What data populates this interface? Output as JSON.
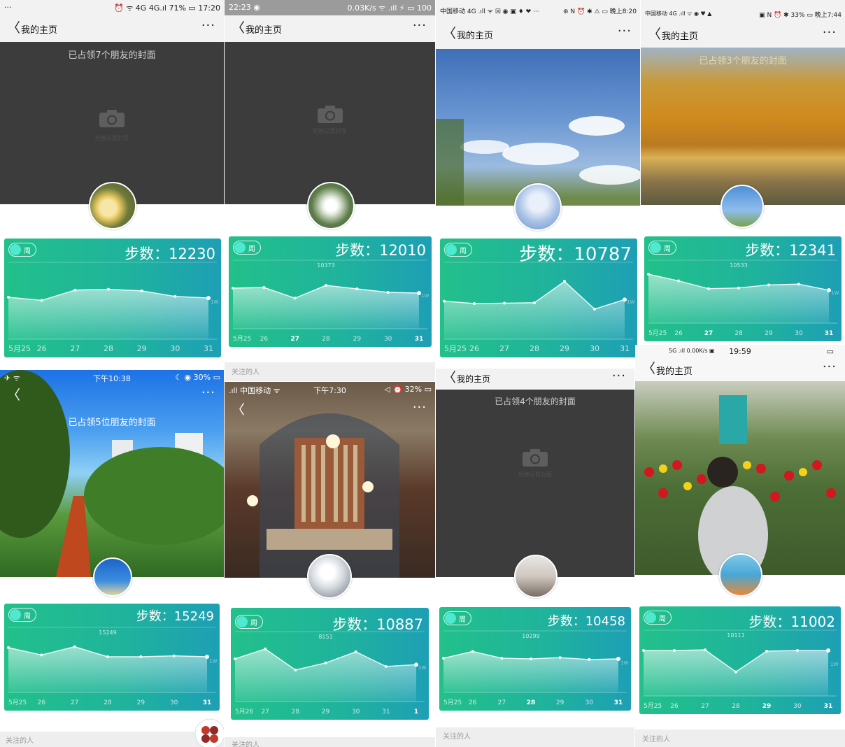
{
  "colors": {
    "card_start": "#22c08a",
    "card_end": "#1e9fb5",
    "cover_dark": "#3c3c3c",
    "toggle_knob": "#4fe8d0"
  },
  "icons": {
    "back": "chevron-left-icon",
    "more": "more-dots-icon",
    "camera": "camera-icon"
  },
  "week_toggle_label": "周",
  "page_title": "我的主页",
  "back_glyph": "〈",
  "more_glyph": "···",
  "panels": [
    {
      "status": {
        "left": "···",
        "right": "⏰ ᯤ 4G 4G.ıl 71% ▭ 17:20"
      },
      "cover_caption": "已占领7个朋友的封面",
      "camera_hint": "轻触设置封面",
      "steps_text": "步数：12230",
      "chart_data": {
        "type": "area",
        "categories": [
          "5月25",
          "26",
          "27",
          "28",
          "29",
          "30",
          "31"
        ],
        "values": [
          11300,
          10900,
          12200,
          12300,
          12100,
          11400,
          11200
        ],
        "ylim": [
          6000,
          15000
        ],
        "peak_label": "",
        "end_label": "1W",
        "bold_last": false
      }
    },
    {
      "status": {
        "left": "22:23 ◉",
        "right": "0.03K/s ᯤ .ıll ⚡ ▭ 100"
      },
      "camera_hint": "轻触设置封面",
      "steps_text": "步数：12010",
      "chart_data": {
        "type": "area",
        "categories": [
          "5月25",
          "26",
          "27",
          "28",
          "29",
          "30",
          "31"
        ],
        "values": [
          11800,
          11900,
          10373,
          12200,
          11700,
          11200,
          11100
        ],
        "ylim": [
          6000,
          15000
        ],
        "peak_label": "10373",
        "end_label": "1W",
        "bold_last": true,
        "bold_index": 2
      },
      "below_label": "关注的人"
    },
    {
      "status": {
        "left": "中国移动 4G .ıll ᯤ ☒ ◉ ▣ ♦ ❤ ···",
        "right": "⊛ N ⏰ ✱ ⚠ ▭ 晚上8:20"
      },
      "steps_text": "步数：10787",
      "chart_data": {
        "type": "area",
        "categories": [
          "5月25",
          "26",
          "27",
          "28",
          "29",
          "30",
          "31"
        ],
        "values": [
          9800,
          9500,
          9550,
          9600,
          12300,
          8800,
          10000
        ],
        "ylim": [
          5000,
          14000
        ],
        "peak_label": "",
        "end_label": "1W",
        "bold_last": false
      }
    },
    {
      "status": {
        "left": "中国移动 4G .ıll ᯤ ◉ ♥ ▲",
        "right": "▣ N ⏰ ✱ 33% ▭ 晚上7:44"
      },
      "cover_caption": "已占领3个朋友的封面",
      "steps_text": "步数：12341",
      "chart_data": {
        "type": "area",
        "categories": [
          "5月25",
          "26",
          "27",
          "28",
          "29",
          "30",
          "31"
        ],
        "values": [
          11400,
          10533,
          9500,
          9600,
          10000,
          10100,
          9300
        ],
        "ylim": [
          5000,
          12500
        ],
        "peak_label": "10533",
        "end_label": "1W",
        "bold_last": true,
        "bold_index": 2
      }
    },
    {
      "status": {
        "left": "✈ ᯤ",
        "center": "下午10:38",
        "right": "☾ ◉ 30% ▭"
      },
      "cover_caption": "已占领5位朋友的封面",
      "steps_text": "步数：15249",
      "chart_data": {
        "type": "area",
        "categories": [
          "5月25",
          "26",
          "27",
          "28",
          "29",
          "30",
          "31"
        ],
        "values": [
          13800,
          12200,
          14000,
          11800,
          11800,
          12000,
          11800
        ],
        "ylim": [
          4000,
          17000
        ],
        "peak_label": "15249",
        "end_label": "1W",
        "bold_last": true
      },
      "below_label": "关注的人"
    },
    {
      "status": {
        "left": ".ıll 中国移动 ᯤ",
        "center": "下午7:30",
        "right": "◁ ⏰ 32% ▭"
      },
      "steps_text": "步数：10887",
      "chart_data": {
        "type": "area",
        "categories": [
          "5月26",
          "27",
          "28",
          "29",
          "30",
          "31",
          "1"
        ],
        "values": [
          10300,
          12000,
          8400,
          9600,
          11500,
          9000,
          9300
        ],
        "ylim": [
          3000,
          14000
        ],
        "peak_label": "8151",
        "end_label": "1W",
        "bold_last": true
      },
      "below_label": "关注的人"
    },
    {
      "cover_caption": "已占领4个朋友的封面",
      "camera_hint": "轻触设置封面",
      "steps_text": "步数：10458",
      "chart_data": {
        "type": "area",
        "categories": [
          "5月25",
          "26",
          "27",
          "28",
          "29",
          "30",
          "31"
        ],
        "values": [
          10500,
          11600,
          10500,
          10400,
          10600,
          10300,
          10400
        ],
        "ylim": [
          5000,
          14000
        ],
        "peak_label": "10299",
        "end_label": "1W",
        "bold_last": true,
        "bold_index": 3
      },
      "below_label": "关注的人"
    },
    {
      "status": {
        "left": "5G .ıll 0.00K/s ▣",
        "center": "19:59",
        "right": "▭"
      },
      "steps_text": "步数：11002",
      "chart_data": {
        "type": "area",
        "categories": [
          "5月25",
          "26",
          "27",
          "28",
          "29",
          "30",
          "31"
        ],
        "values": [
          10800,
          10800,
          10900,
          7600,
          10700,
          10800,
          10800
        ],
        "ylim": [
          4000,
          13000
        ],
        "peak_label": "10111",
        "end_label": "1W",
        "bold_last": true,
        "bold_index": 4
      },
      "below_label": "关注的人"
    }
  ]
}
